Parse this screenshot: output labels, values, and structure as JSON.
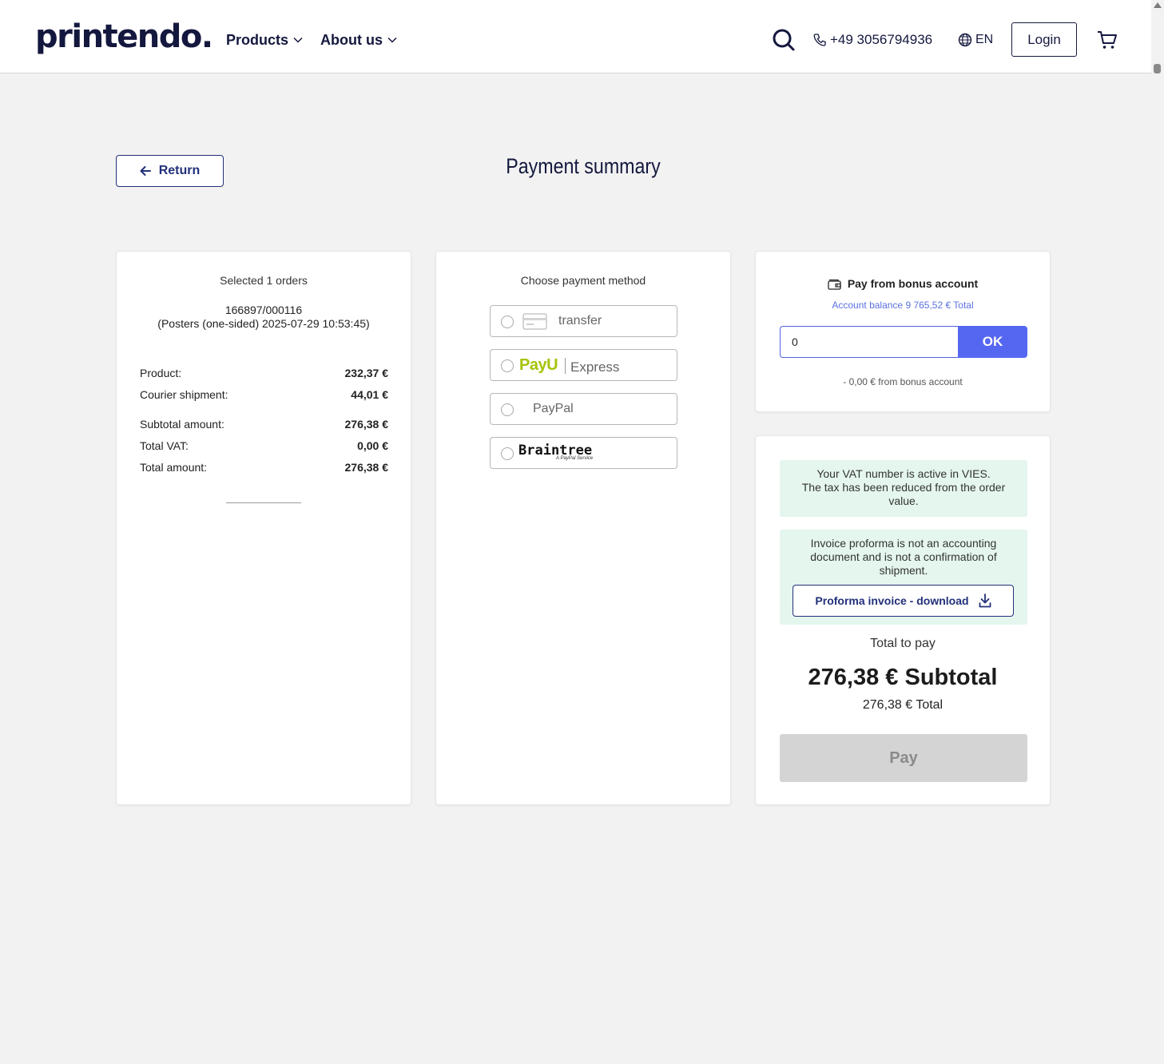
{
  "header": {
    "logo": "printendo.",
    "nav": {
      "products": "Products",
      "about": "About us"
    },
    "phone": "+49 3056794936",
    "language": "EN",
    "login": "Login",
    "icons": {
      "search": "search-icon",
      "phone": "phone-icon",
      "globe": "globe-icon",
      "cart": "cart-icon"
    },
    "brand_color": "#14183e"
  },
  "page": {
    "return_label": "Return",
    "title": "Payment summary"
  },
  "summary": {
    "heading": "Selected 1 orders",
    "order_id": "166897/000116",
    "order_desc": "(Posters (one-sided) 2025-07-29 10:53:45)",
    "rows": [
      {
        "label": "Product:",
        "value": "232,37 €"
      },
      {
        "label": "Courier shipment:",
        "value": "44,01 €"
      },
      {
        "label": "Subtotal amount:",
        "value": "276,38 €"
      },
      {
        "label": "Total VAT:",
        "value": "0,00 €"
      },
      {
        "label": "Total amount:",
        "value": "276,38 €"
      }
    ]
  },
  "payment_methods": {
    "heading": "Choose payment method",
    "items": [
      {
        "name": "transfer",
        "label": "transfer",
        "icon": "card-icon"
      },
      {
        "name": "payu",
        "logo_text": "PayU",
        "label": "Express"
      },
      {
        "name": "paypal",
        "label": "PayPal"
      },
      {
        "name": "braintree",
        "logo_text": "Braintree",
        "sub_text": "A PayPal Service"
      }
    ]
  },
  "bonus": {
    "heading": "Pay from bonus account",
    "balance": "Account balance 9 765,52 € Total",
    "input_value": "0",
    "ok_label": "OK",
    "note": "- 0,00 € from bonus account",
    "accent_color": "#5567f0"
  },
  "totals": {
    "vat_note_line1": "Your VAT number is active in VIES.",
    "vat_note_line2": "The tax has been reduced from the order value.",
    "proforma_note": "Invoice proforma is not an accounting document and is not a confirmation of shipment.",
    "proforma_button": "Proforma invoice - download",
    "total_label": "Total to pay",
    "total_big": "276,38 € Subtotal",
    "total_small": "276,38 € Total",
    "pay_label": "Pay"
  }
}
